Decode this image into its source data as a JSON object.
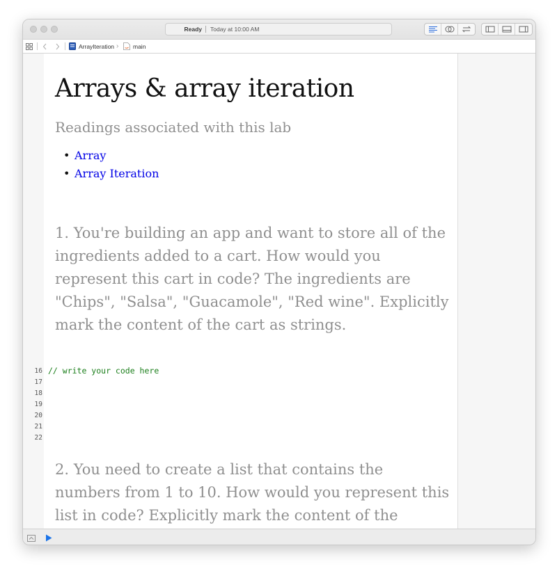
{
  "window": {
    "status": {
      "state": "Ready",
      "time": "Today at 10:00 AM"
    }
  },
  "pathbar": {
    "project": "ArrayIteration",
    "file": "main"
  },
  "page": {
    "title": "Arrays & array iteration",
    "subtitle": "Readings associated with this lab",
    "links": [
      "Array",
      "Array Iteration"
    ],
    "question1": "1. You're building an app and want to store all of the ingredients added to a cart. How would you represent this cart in code? The ingredients are \"Chips\", \"Salsa\", \"Guacamole\", \"Red wine\". Explicitly mark the content of the cart as strings.",
    "code_comment": "// write your code here",
    "line_numbers": [
      "16",
      "17",
      "18",
      "19",
      "20",
      "21",
      "22"
    ],
    "question2": "2. You need to create a list that contains the numbers from 1 to 10. How would you represent this list in code? Explicitly mark the content of the"
  },
  "colors": {
    "link": "#0000e6",
    "code_comment": "#1a7e1a",
    "muted_text": "#8f8f8f",
    "run_button": "#1a73e8"
  },
  "icons": {
    "toolbar": [
      "standard-editor-icon",
      "assistant-editor-icon",
      "version-editor-icon",
      "navigator-toggle-icon",
      "debug-area-toggle-icon",
      "inspector-toggle-icon"
    ],
    "pathbar": [
      "grid-icon",
      "back-arrow-icon",
      "forward-arrow-icon",
      "playground-file-icon",
      "swift-file-icon"
    ],
    "bottom": [
      "console-toggle-icon",
      "run-play-icon"
    ]
  }
}
